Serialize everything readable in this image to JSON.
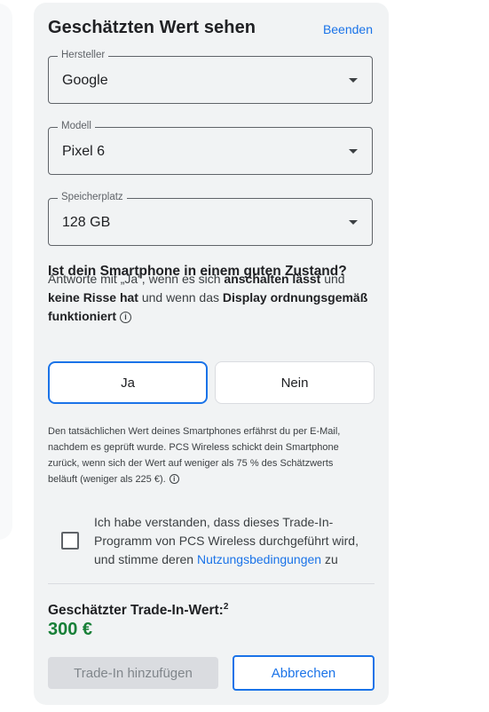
{
  "header": {
    "title": "Geschätzten Wert sehen",
    "end_link": "Beenden"
  },
  "fields": {
    "manufacturer": {
      "label": "Hersteller",
      "value": "Google"
    },
    "model": {
      "label": "Modell",
      "value": "Pixel 6"
    },
    "storage": {
      "label": "Speicherplatz",
      "value": "128 GB"
    }
  },
  "condition": {
    "question": "Ist dein Smartphone in einem guten Zustand?",
    "text_1": "Antworte mit „Ja“, wenn es sich ",
    "bold_1": "anschalten lässt",
    "text_2": " und ",
    "bold_2": "keine Risse hat",
    "text_3": " und wenn das ",
    "bold_3": "Display ordnungsgemäß funktioniert",
    "yes_label": "Ja",
    "no_label": "Nein",
    "selected": "Ja"
  },
  "note": "Den tatsächlichen Wert deines Smartphones erfährst du per E-Mail, nachdem es geprüft wurde. PCS Wireless schickt dein Smartphone zurück, wenn sich der Wert auf weniger als 75 % des Schätzwerts beläuft (weniger als 225 €).",
  "consent": {
    "text_before": "Ich habe verstanden, dass dieses Trade-In-Programm von PCS Wireless durchgeführt wird, und stimme deren ",
    "link": "Nutzungsbedingungen",
    "text_after": " zu",
    "checked": false
  },
  "estimate": {
    "label": "Geschätzter Trade-In-Wert:",
    "footnote": "2",
    "value": "300 €"
  },
  "actions": {
    "add_label": "Trade-In hinzufügen",
    "cancel_label": "Abbrechen"
  },
  "colors": {
    "accent": "#1a73e8",
    "price": "#188038",
    "card_bg": "#f1f3f4"
  },
  "icons": [
    "dropdown-arrow-icon",
    "info-icon"
  ]
}
